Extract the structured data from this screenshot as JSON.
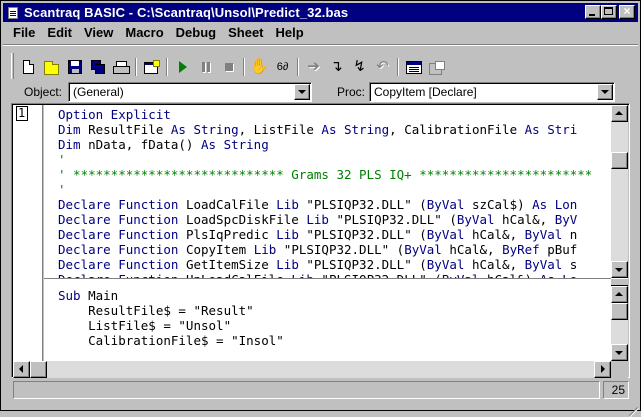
{
  "window": {
    "title": "Scantraq BASIC - C:\\Scantraq\\Unsol\\Predict_32.bas"
  },
  "menu": [
    "File",
    "Edit",
    "View",
    "Macro",
    "Debug",
    "Sheet",
    "Help"
  ],
  "toolbar": {
    "buttons": [
      "new-file-icon",
      "open-file-icon",
      "save-icon",
      "save-all-icon",
      "print-icon",
      "user-dialog-icon",
      "run-icon",
      "pause-icon",
      "stop-icon",
      "toggle-breakpoint-icon",
      "quick-watch-icon",
      "step-into-icon",
      "step-over-icon",
      "step-out-icon",
      "step-to-cursor-icon",
      "properties-icon",
      "object-browser-icon"
    ]
  },
  "object_selector": {
    "label": "Object:",
    "value": "(General)"
  },
  "proc_selector": {
    "label": "Proc:",
    "value": "CopyItem [Declare]"
  },
  "editor": {
    "line_number": "1",
    "top_pane": [
      [
        [
          "kw",
          "Option Explicit"
        ]
      ],
      [
        [
          "kw",
          "Dim"
        ],
        [
          "st",
          " ResultFile "
        ],
        [
          "kw",
          "As String"
        ],
        [
          "st",
          ", ListFile "
        ],
        [
          "kw",
          "As String"
        ],
        [
          "st",
          ", CalibrationFile "
        ],
        [
          "kw",
          "As Stri"
        ]
      ],
      [
        [
          "kw",
          "Dim"
        ],
        [
          "st",
          " nData, fData() "
        ],
        [
          "kw",
          "As String"
        ]
      ],
      [
        [
          "cm",
          "'"
        ]
      ],
      [
        [
          "cm",
          "' **************************** Grams 32 PLS IQ+ ***********************"
        ]
      ],
      [
        [
          "cm",
          "'"
        ]
      ],
      [
        [
          "kw",
          "Declare Function"
        ],
        [
          "st",
          " LoadCalFile "
        ],
        [
          "kw",
          "Lib"
        ],
        [
          "st",
          " \"PLSIQP32.DLL\" ("
        ],
        [
          "kw",
          "ByVal"
        ],
        [
          "st",
          " szCal$) "
        ],
        [
          "kw",
          "As Lon"
        ]
      ],
      [
        [
          "kw",
          "Declare Function"
        ],
        [
          "st",
          " LoadSpcDiskFile "
        ],
        [
          "kw",
          "Lib"
        ],
        [
          "st",
          " \"PLSIQP32.DLL\" ("
        ],
        [
          "kw",
          "ByVal"
        ],
        [
          "st",
          " hCal&, "
        ],
        [
          "kw",
          "ByV"
        ]
      ],
      [
        [
          "kw",
          "Declare Function"
        ],
        [
          "st",
          " PlsIqPredic "
        ],
        [
          "kw",
          "Lib"
        ],
        [
          "st",
          " \"PLSIQP32.DLL\" ("
        ],
        [
          "kw",
          "ByVal"
        ],
        [
          "st",
          " hCal&, "
        ],
        [
          "kw",
          "ByVal"
        ],
        [
          "st",
          " n"
        ]
      ],
      [
        [
          "kw",
          "Declare Function"
        ],
        [
          "st",
          " CopyItem "
        ],
        [
          "kw",
          "Lib"
        ],
        [
          "st",
          " \"PLSIQP32.DLL\" ("
        ],
        [
          "kw",
          "ByVal"
        ],
        [
          "st",
          " hCal&, "
        ],
        [
          "kw",
          "ByRef"
        ],
        [
          "st",
          " pBuf"
        ]
      ],
      [
        [
          "kw",
          "Declare Function"
        ],
        [
          "st",
          " GetItemSize "
        ],
        [
          "kw",
          "Lib"
        ],
        [
          "st",
          " \"PLSIQP32.DLL\" ("
        ],
        [
          "kw",
          "ByVal"
        ],
        [
          "st",
          " hCal&, "
        ],
        [
          "kw",
          "ByVal"
        ],
        [
          "st",
          " s"
        ]
      ],
      [
        [
          "kw",
          "Declare Function"
        ],
        [
          "st",
          " UnLoadCalFile "
        ],
        [
          "kw",
          "Lib"
        ],
        [
          "st",
          " \"PLSIQP32.DLL\" ("
        ],
        [
          "kw",
          "ByVal"
        ],
        [
          "st",
          " hCal&) "
        ],
        [
          "kw",
          "As Lo"
        ]
      ]
    ],
    "bottom_pane": [
      [
        [
          "kw",
          "Sub"
        ],
        [
          "st",
          " Main"
        ]
      ],
      [
        [
          "st",
          "    ResultFile$ = \"Result\""
        ]
      ],
      [
        [
          "st",
          "    ListFile$ = \"Unsol\""
        ]
      ],
      [
        [
          "st",
          "    CalibrationFile$ = \"Insol\""
        ]
      ]
    ]
  },
  "status": {
    "message": "",
    "line": "25"
  }
}
